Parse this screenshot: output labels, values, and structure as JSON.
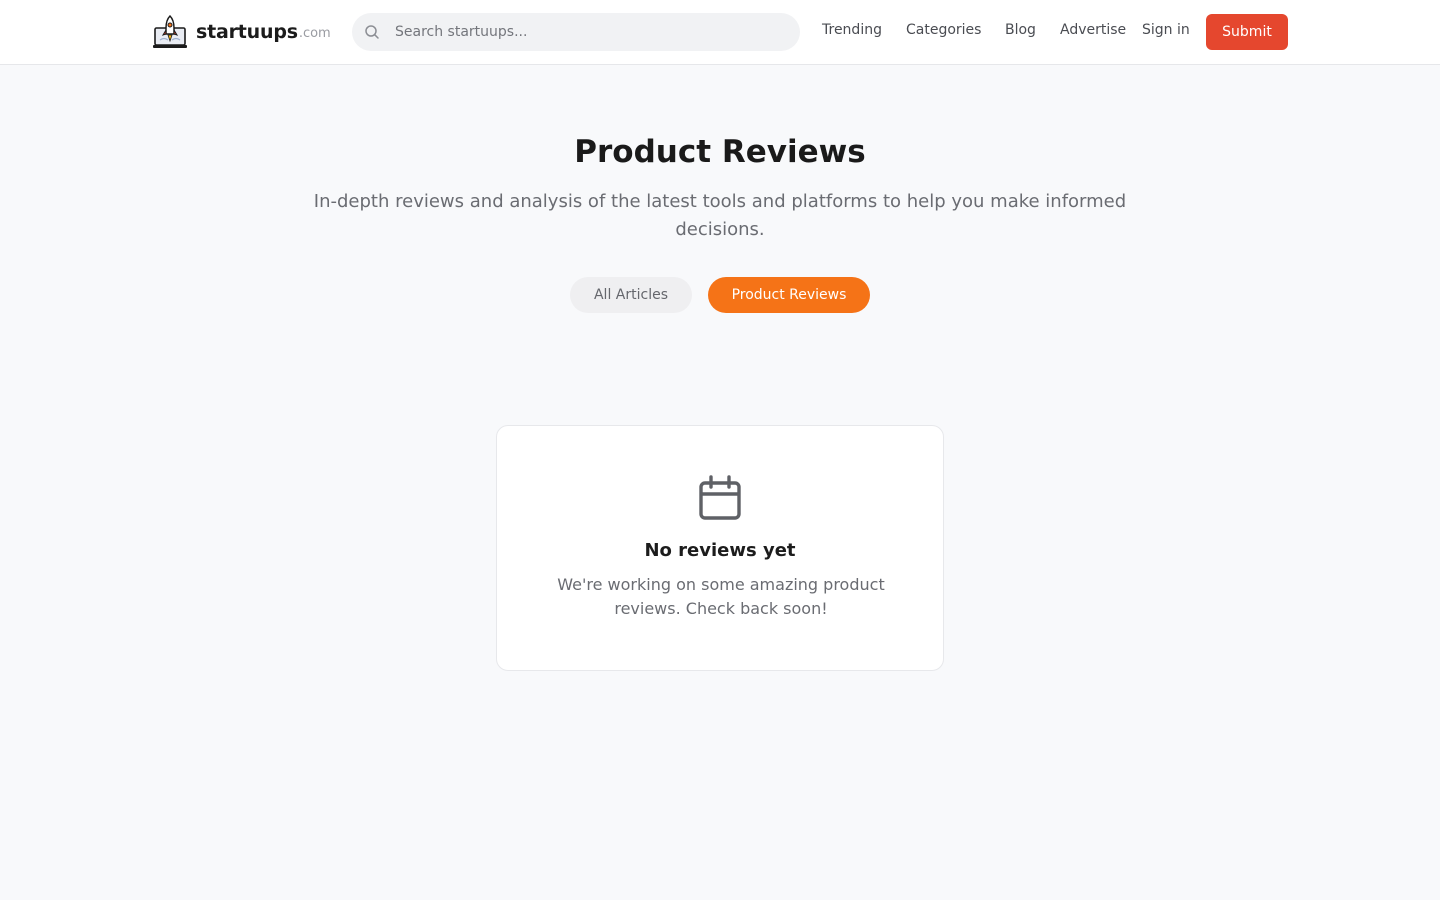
{
  "header": {
    "logo_name": "startuups",
    "logo_tld": ".com",
    "search_placeholder": "Search startuups...",
    "nav": {
      "trending": "Trending",
      "categories": "Categories",
      "blog": "Blog",
      "advertise": "Advertise",
      "sign_in": "Sign in"
    },
    "submit_label": "Submit",
    "icons": [
      "rocket-laptop-logo-icon",
      "search-icon"
    ]
  },
  "main": {
    "title": "Product Reviews",
    "subtitle": "In-depth reviews and analysis of the latest tools and platforms to help you make informed decisions.",
    "filters": {
      "all_articles": "All Articles",
      "product_reviews": "Product Reviews"
    },
    "active_filter": "Product Reviews",
    "empty_state": {
      "icon": "calendar-icon",
      "title": "No reviews yet",
      "message": "We're working on some amazing product reviews. Check back soon!"
    }
  },
  "colors": {
    "accent_orange": "#f57317",
    "submit_red": "#e5472e",
    "page_background": "#f8f9fb"
  }
}
